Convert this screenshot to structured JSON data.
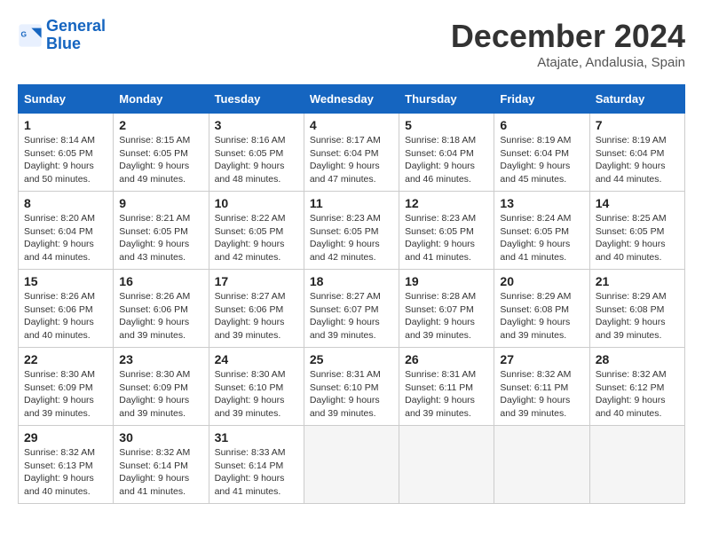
{
  "logo": {
    "line1": "General",
    "line2": "Blue"
  },
  "title": "December 2024",
  "location": "Atajate, Andalusia, Spain",
  "weekdays": [
    "Sunday",
    "Monday",
    "Tuesday",
    "Wednesday",
    "Thursday",
    "Friday",
    "Saturday"
  ],
  "weeks": [
    [
      {
        "day": 1,
        "sunrise": "8:14 AM",
        "sunset": "6:05 PM",
        "daylight": "9 hours and 50 minutes."
      },
      {
        "day": 2,
        "sunrise": "8:15 AM",
        "sunset": "6:05 PM",
        "daylight": "9 hours and 49 minutes."
      },
      {
        "day": 3,
        "sunrise": "8:16 AM",
        "sunset": "6:05 PM",
        "daylight": "9 hours and 48 minutes."
      },
      {
        "day": 4,
        "sunrise": "8:17 AM",
        "sunset": "6:04 PM",
        "daylight": "9 hours and 47 minutes."
      },
      {
        "day": 5,
        "sunrise": "8:18 AM",
        "sunset": "6:04 PM",
        "daylight": "9 hours and 46 minutes."
      },
      {
        "day": 6,
        "sunrise": "8:19 AM",
        "sunset": "6:04 PM",
        "daylight": "9 hours and 45 minutes."
      },
      {
        "day": 7,
        "sunrise": "8:19 AM",
        "sunset": "6:04 PM",
        "daylight": "9 hours and 44 minutes."
      }
    ],
    [
      {
        "day": 8,
        "sunrise": "8:20 AM",
        "sunset": "6:04 PM",
        "daylight": "9 hours and 44 minutes."
      },
      {
        "day": 9,
        "sunrise": "8:21 AM",
        "sunset": "6:05 PM",
        "daylight": "9 hours and 43 minutes."
      },
      {
        "day": 10,
        "sunrise": "8:22 AM",
        "sunset": "6:05 PM",
        "daylight": "9 hours and 42 minutes."
      },
      {
        "day": 11,
        "sunrise": "8:23 AM",
        "sunset": "6:05 PM",
        "daylight": "9 hours and 42 minutes."
      },
      {
        "day": 12,
        "sunrise": "8:23 AM",
        "sunset": "6:05 PM",
        "daylight": "9 hours and 41 minutes."
      },
      {
        "day": 13,
        "sunrise": "8:24 AM",
        "sunset": "6:05 PM",
        "daylight": "9 hours and 41 minutes."
      },
      {
        "day": 14,
        "sunrise": "8:25 AM",
        "sunset": "6:05 PM",
        "daylight": "9 hours and 40 minutes."
      }
    ],
    [
      {
        "day": 15,
        "sunrise": "8:26 AM",
        "sunset": "6:06 PM",
        "daylight": "9 hours and 40 minutes."
      },
      {
        "day": 16,
        "sunrise": "8:26 AM",
        "sunset": "6:06 PM",
        "daylight": "9 hours and 39 minutes."
      },
      {
        "day": 17,
        "sunrise": "8:27 AM",
        "sunset": "6:06 PM",
        "daylight": "9 hours and 39 minutes."
      },
      {
        "day": 18,
        "sunrise": "8:27 AM",
        "sunset": "6:07 PM",
        "daylight": "9 hours and 39 minutes."
      },
      {
        "day": 19,
        "sunrise": "8:28 AM",
        "sunset": "6:07 PM",
        "daylight": "9 hours and 39 minutes."
      },
      {
        "day": 20,
        "sunrise": "8:29 AM",
        "sunset": "6:08 PM",
        "daylight": "9 hours and 39 minutes."
      },
      {
        "day": 21,
        "sunrise": "8:29 AM",
        "sunset": "6:08 PM",
        "daylight": "9 hours and 39 minutes."
      }
    ],
    [
      {
        "day": 22,
        "sunrise": "8:30 AM",
        "sunset": "6:09 PM",
        "daylight": "9 hours and 39 minutes."
      },
      {
        "day": 23,
        "sunrise": "8:30 AM",
        "sunset": "6:09 PM",
        "daylight": "9 hours and 39 minutes."
      },
      {
        "day": 24,
        "sunrise": "8:30 AM",
        "sunset": "6:10 PM",
        "daylight": "9 hours and 39 minutes."
      },
      {
        "day": 25,
        "sunrise": "8:31 AM",
        "sunset": "6:10 PM",
        "daylight": "9 hours and 39 minutes."
      },
      {
        "day": 26,
        "sunrise": "8:31 AM",
        "sunset": "6:11 PM",
        "daylight": "9 hours and 39 minutes."
      },
      {
        "day": 27,
        "sunrise": "8:32 AM",
        "sunset": "6:11 PM",
        "daylight": "9 hours and 39 minutes."
      },
      {
        "day": 28,
        "sunrise": "8:32 AM",
        "sunset": "6:12 PM",
        "daylight": "9 hours and 40 minutes."
      }
    ],
    [
      {
        "day": 29,
        "sunrise": "8:32 AM",
        "sunset": "6:13 PM",
        "daylight": "9 hours and 40 minutes."
      },
      {
        "day": 30,
        "sunrise": "8:32 AM",
        "sunset": "6:14 PM",
        "daylight": "9 hours and 41 minutes."
      },
      {
        "day": 31,
        "sunrise": "8:33 AM",
        "sunset": "6:14 PM",
        "daylight": "9 hours and 41 minutes."
      },
      null,
      null,
      null,
      null
    ]
  ]
}
